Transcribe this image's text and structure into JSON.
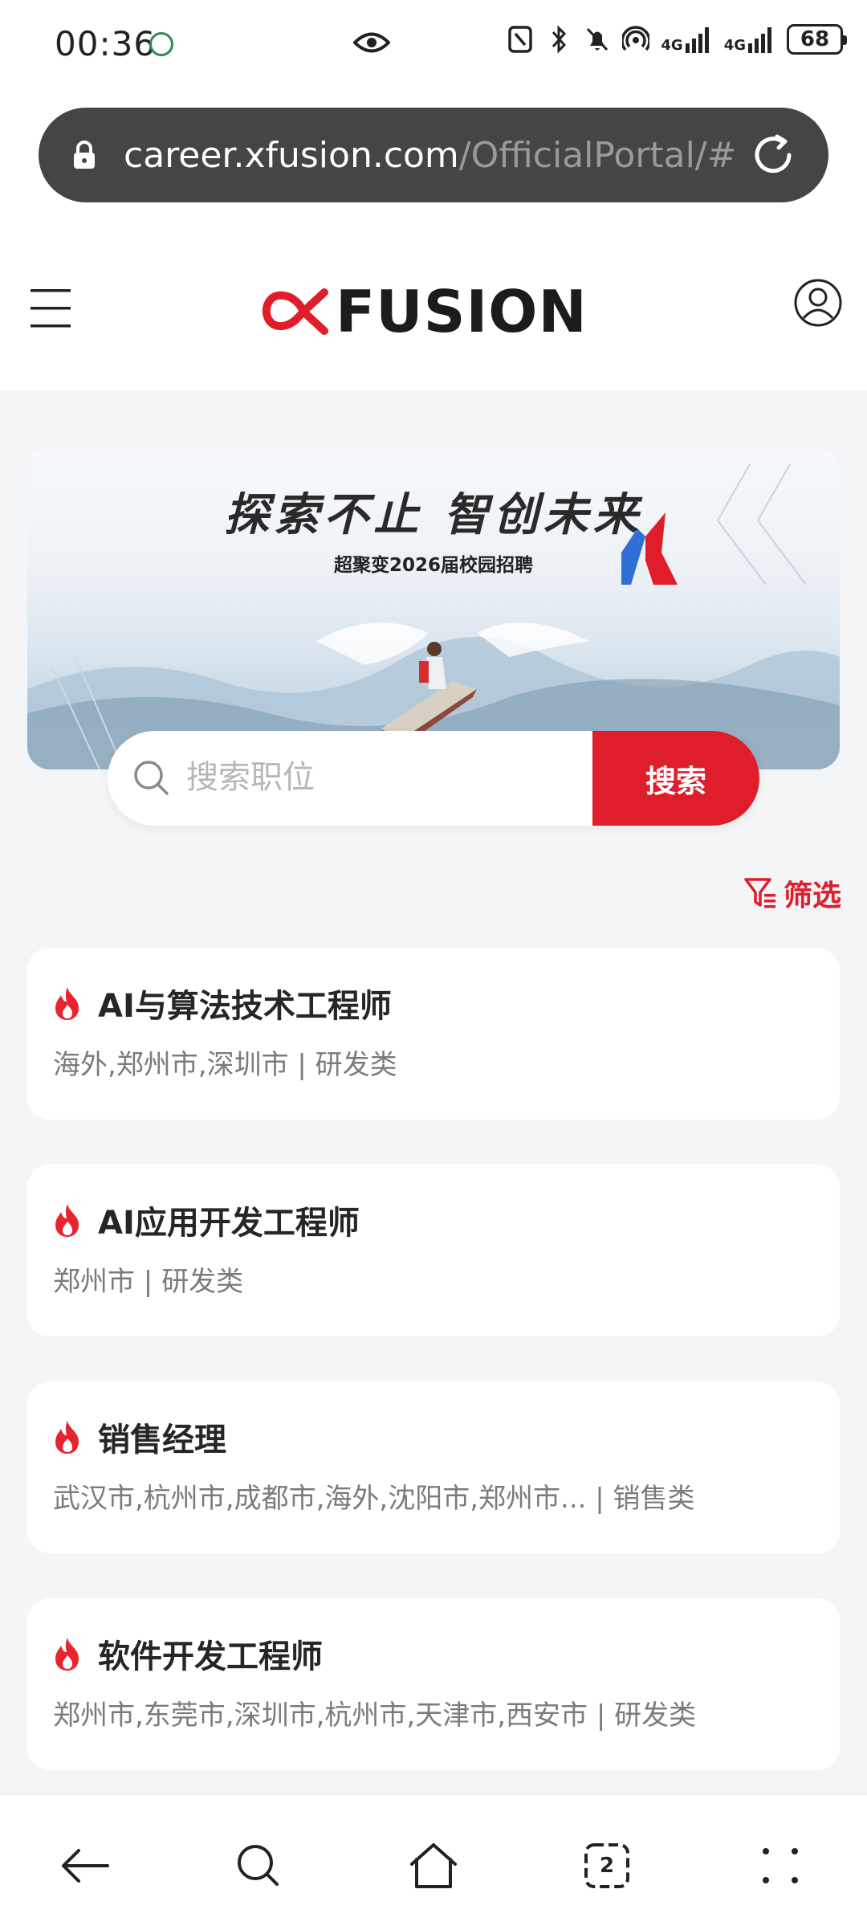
{
  "status_bar": {
    "time": "00:36",
    "network_1": "4G",
    "network_2": "4G",
    "battery": "68"
  },
  "browser": {
    "url_host": "career.xfusion.com",
    "url_path": "/OfficialPortal/#"
  },
  "header": {
    "logo_text": "FUSION",
    "logo_color": "#e01d2a"
  },
  "banner": {
    "title": "探索不止 智创未来",
    "subtitle": "超聚变2026届校园招聘"
  },
  "search": {
    "placeholder": "搜索职位",
    "button_label": "搜索"
  },
  "filter_label": "筛选",
  "jobs": [
    {
      "title": "AI与算法技术工程师",
      "meta": "海外,郑州市,深圳市 | 研发类"
    },
    {
      "title": "AI应用开发工程师",
      "meta": "郑州市 | 研发类"
    },
    {
      "title": "销售经理",
      "meta": "武汉市,杭州市,成都市,海外,沈阳市,郑州市... | 销售类"
    },
    {
      "title": "软件开发工程师",
      "meta": "郑州市,东莞市,深圳市,杭州市,天津市,西安市 | 研发类"
    }
  ],
  "nav": {
    "tab_count": "2"
  },
  "colors": {
    "accent": "#e01d2a",
    "page_bg": "#f4f5f7"
  }
}
